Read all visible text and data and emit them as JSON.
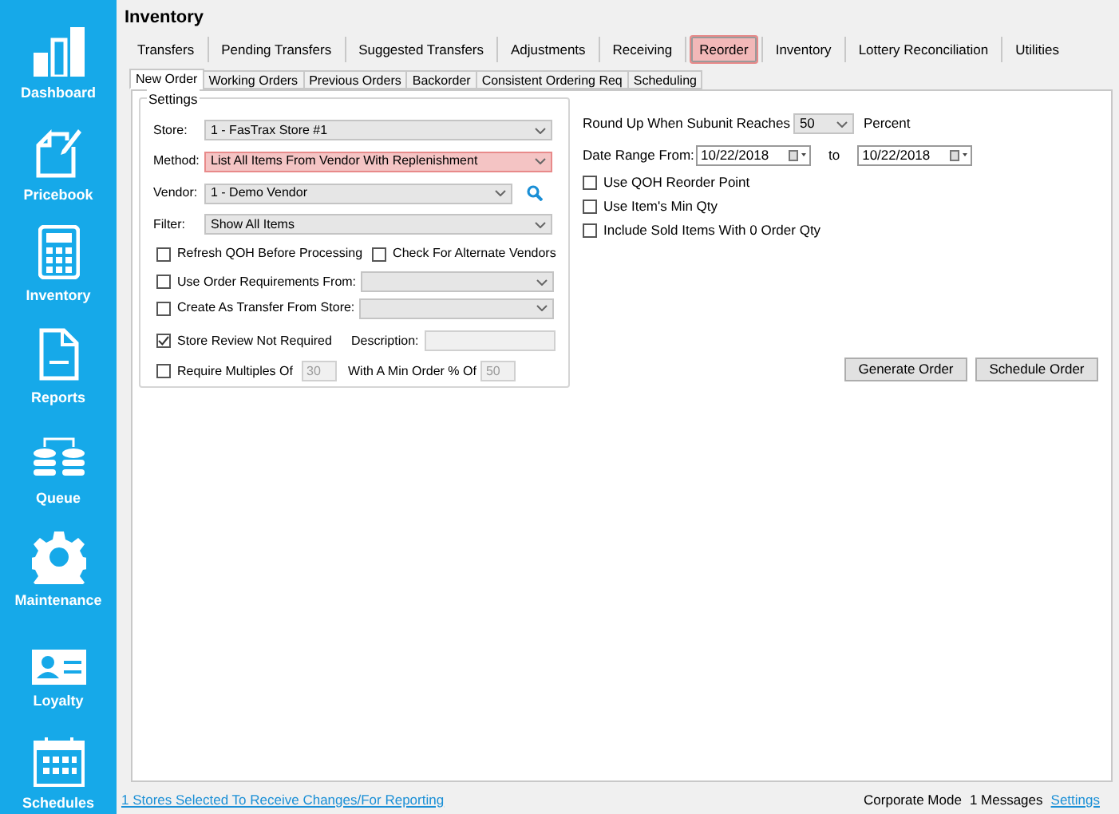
{
  "sidebar": {
    "items": [
      {
        "label": "Dashboard"
      },
      {
        "label": "Pricebook"
      },
      {
        "label": "Inventory"
      },
      {
        "label": "Reports"
      },
      {
        "label": "Queue"
      },
      {
        "label": "Maintenance"
      },
      {
        "label": "Loyalty"
      },
      {
        "label": "Schedules"
      }
    ]
  },
  "title": "Inventory",
  "tabs": [
    {
      "label": "Transfers",
      "selected": false,
      "highlighted": false
    },
    {
      "label": "Pending Transfers",
      "selected": false,
      "highlighted": false
    },
    {
      "label": "Suggested Transfers",
      "selected": false,
      "highlighted": false
    },
    {
      "label": "Adjustments",
      "selected": false,
      "highlighted": false
    },
    {
      "label": "Receiving",
      "selected": false,
      "highlighted": false
    },
    {
      "label": "Reorder",
      "selected": true,
      "highlighted": true
    },
    {
      "label": "Inventory",
      "selected": false,
      "highlighted": false
    },
    {
      "label": "Lottery Reconciliation",
      "selected": false,
      "highlighted": false
    },
    {
      "label": "Utilities",
      "selected": false,
      "highlighted": false
    }
  ],
  "subtabs": [
    {
      "label": "New Order",
      "selected": true
    },
    {
      "label": "Working Orders",
      "selected": false
    },
    {
      "label": "Previous Orders",
      "selected": false
    },
    {
      "label": "Backorder",
      "selected": false
    },
    {
      "label": "Consistent Ordering Req",
      "selected": false
    },
    {
      "label": "Scheduling",
      "selected": false
    }
  ],
  "settings": {
    "title": "Settings",
    "dropdowns": [
      {
        "label": "Store:",
        "value": "1 - FasTrax Store #1",
        "highlighted": false,
        "search": false
      },
      {
        "label": "Method:",
        "value": "List All Items From Vendor With Replenishment",
        "highlighted": true,
        "search": false
      },
      {
        "label": "Vendor:",
        "value": "1 - Demo Vendor",
        "highlighted": false,
        "search": true
      },
      {
        "label": "Filter:",
        "value": "Show All Items",
        "highlighted": false,
        "search": false
      }
    ],
    "refresh_qoh": {
      "label": "Refresh QOH Before Processing",
      "checked": false
    },
    "alternate_vendors": {
      "label": "Check For Alternate Vendors",
      "checked": false
    },
    "order_requirements": {
      "label": "Use Order Requirements From:",
      "checked": false
    },
    "transfer_from_store": {
      "label": "Create As Transfer From Store:",
      "checked": false
    },
    "store_review": {
      "label": "Store Review Not Required",
      "checked": true,
      "description_label": "Description:"
    },
    "require_multiples": {
      "label": "Require Multiples Of",
      "checked": false,
      "value": "30",
      "disabled": true,
      "min_order_label": "With A Min Order % Of",
      "min_order_value": "50"
    }
  },
  "options": {
    "round_up": {
      "label": "Round Up When Subunit Reaches",
      "value": "50",
      "suffix": "Percent"
    },
    "date_range": {
      "label": "Date Range From:",
      "from": "10/22/2018",
      "to_label": "to",
      "to": "10/22/2018"
    },
    "checkboxes": [
      {
        "label": "Use QOH Reorder Point",
        "checked": false
      },
      {
        "label": "Use Item's Min Qty",
        "checked": false
      },
      {
        "label": "Include Sold Items With 0 Order Qty",
        "checked": false
      }
    ]
  },
  "buttons": [
    "Generate Order",
    "Schedule Order"
  ],
  "status_bar": {
    "stores_link": "1 Stores Selected To Receive Changes/For Reporting",
    "mode": "Corporate Mode",
    "messages": "1 Messages",
    "settings_link": "Settings"
  }
}
